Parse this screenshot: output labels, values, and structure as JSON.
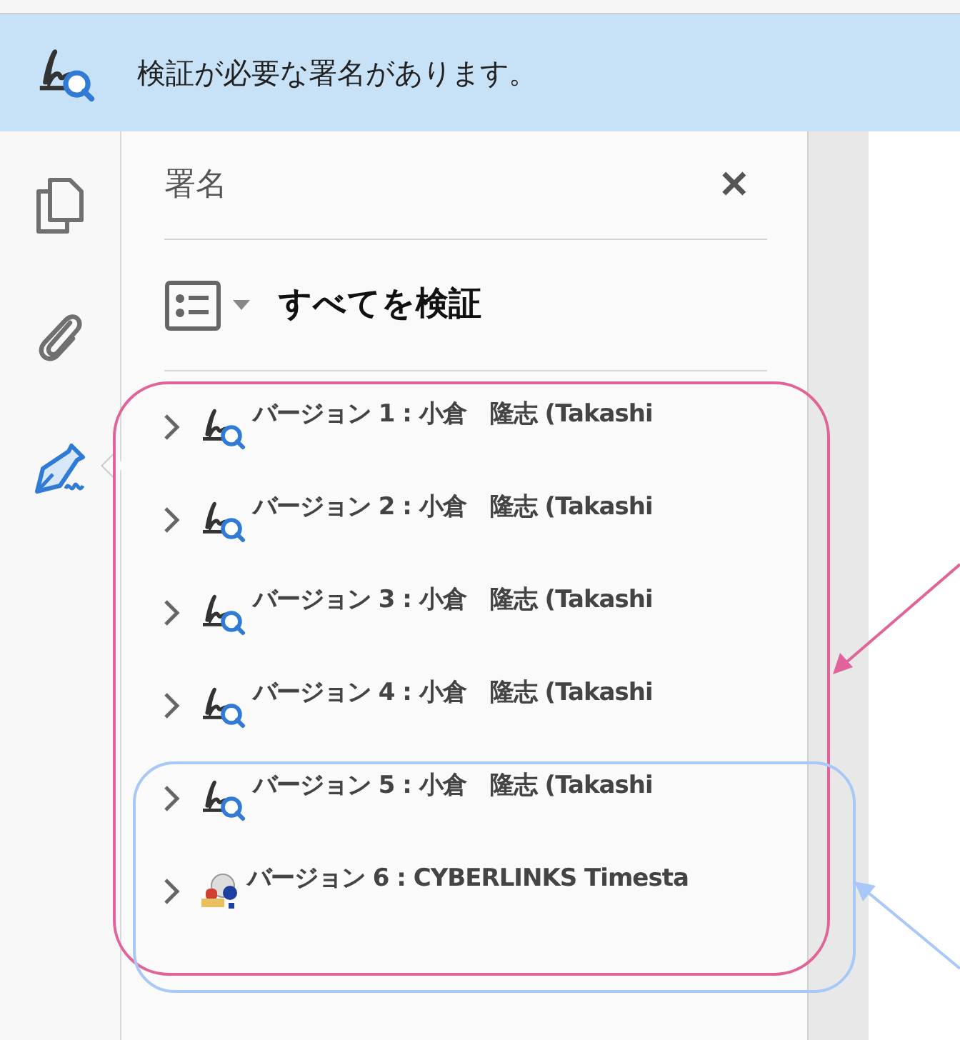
{
  "banner": {
    "message": "検証が必要な署名があります。"
  },
  "rail": [
    {
      "kind": "pages",
      "selected": false
    },
    {
      "kind": "attachments",
      "selected": false
    },
    {
      "kind": "signatures",
      "selected": true
    }
  ],
  "panel": {
    "title": "署名",
    "close": "✕",
    "verify_all": "すべてを検証"
  },
  "signatures": [
    {
      "kind": "signature",
      "label": "バージョン 1 : 小倉　隆志 (Takashi",
      "expanded": false
    },
    {
      "kind": "signature",
      "label": "バージョン 2 : 小倉　隆志 (Takashi",
      "expanded": false
    },
    {
      "kind": "signature",
      "label": "バージョン 3 : 小倉　隆志 (Takashi",
      "expanded": false
    },
    {
      "kind": "signature",
      "label": "バージョン 4 : 小倉　隆志 (Takashi",
      "expanded": false
    },
    {
      "kind": "signature",
      "label": "バージョン 5 : 小倉　隆志 (Takashi",
      "expanded": false
    },
    {
      "kind": "timestamp",
      "label": "バージョン 6 : CYBERLINKS Timesta",
      "expanded": false
    }
  ]
}
